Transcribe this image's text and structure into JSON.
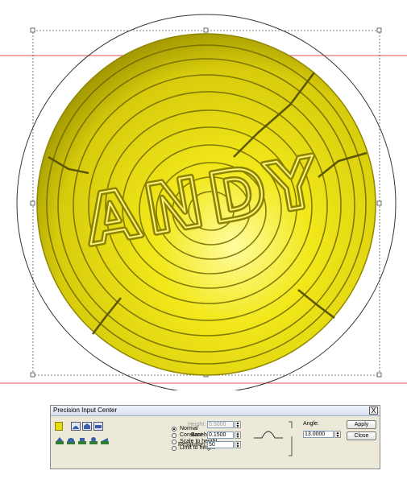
{
  "dialog": {
    "title": "Precision Input Center",
    "close_glyph": "X",
    "modes": [
      {
        "label": "Normal",
        "selected": true
      },
      {
        "label": "Constant height",
        "selected": false
      },
      {
        "label": "Scale to height",
        "selected": false
      },
      {
        "label": "Limit to height",
        "selected": false
      }
    ],
    "height_label": "Height:",
    "height_value": "0.5000",
    "base_label": "Base:",
    "base_value": "0.1500",
    "resolution_label": "Resolution:",
    "resolution_value": "50",
    "angle_label": "Angle:",
    "angle_value": "13.0000",
    "apply_label": "Apply",
    "close_label": "Close"
  },
  "colors": {
    "relief": "#e6dc12",
    "relief_dark": "#8f8600",
    "guide_line": "#e05050",
    "selection_box": "#555555"
  },
  "icons": {
    "color_swatch": "yellow-color-swatch-icon",
    "top_row": [
      "dome-profile-icon",
      "arch-profile-icon",
      "flat-profile-icon"
    ],
    "bottom_row": [
      "relief-tool-1-icon",
      "relief-tool-2-icon",
      "relief-tool-3-icon",
      "relief-tool-4-icon",
      "relief-tool-5-icon"
    ]
  }
}
